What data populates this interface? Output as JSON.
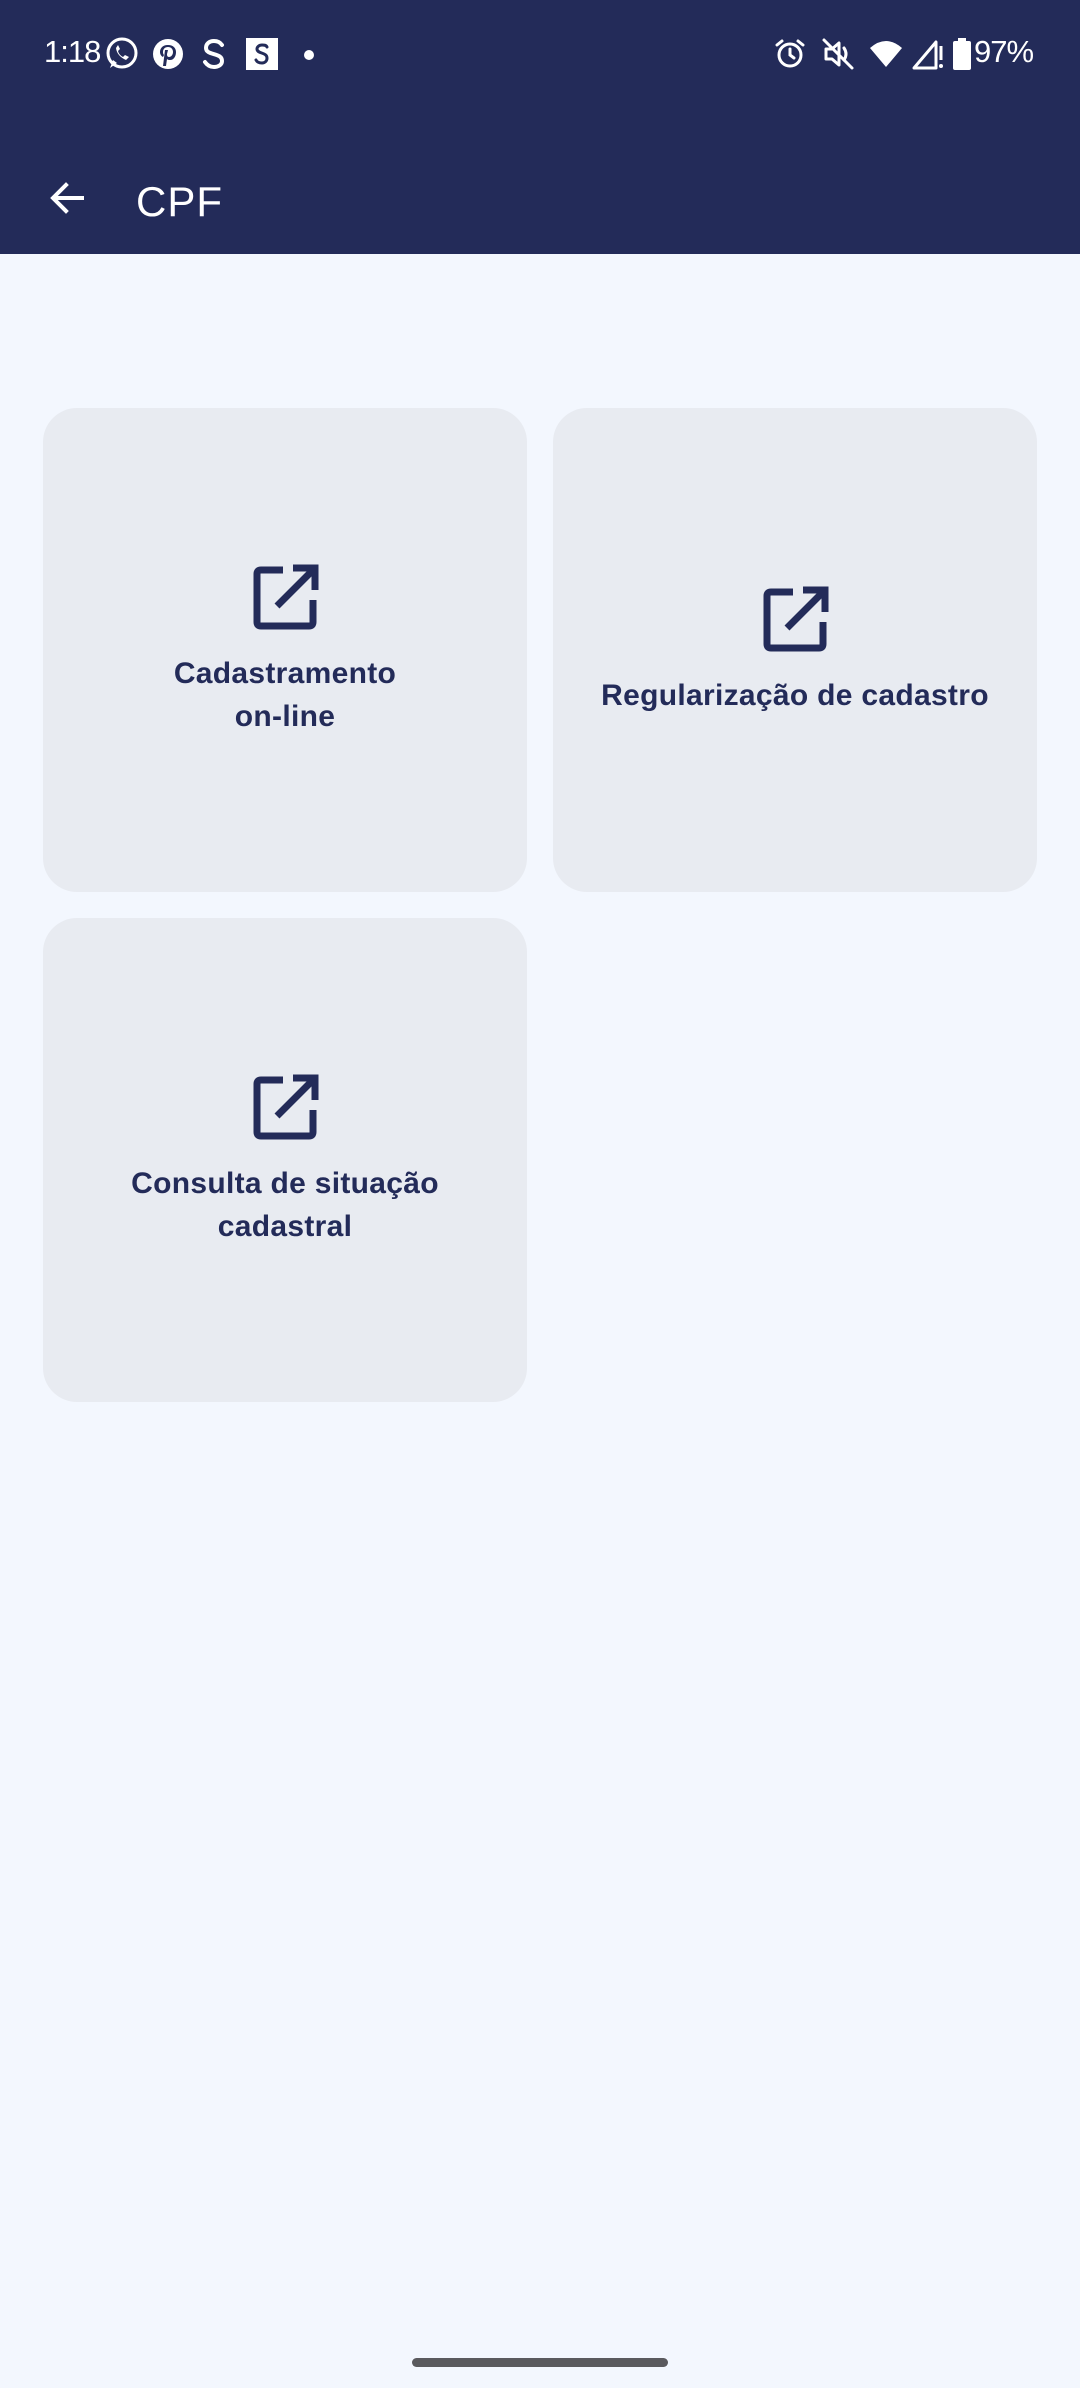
{
  "status_bar": {
    "time": "1:18",
    "battery": "97%",
    "left_icons": [
      "whatsapp-icon",
      "pinterest-icon",
      "s-app-icon",
      "s-square-icon",
      "notification-dot"
    ],
    "right_icons": [
      "alarm-icon",
      "vibrate-off-icon",
      "wifi-icon",
      "signal-icon",
      "battery-icon"
    ]
  },
  "app_bar": {
    "back_icon": "arrow-back-icon",
    "title": "CPF"
  },
  "cards": [
    {
      "label": "Cadastramento on-line",
      "icon": "open-external-icon"
    },
    {
      "label": "Regularização de cadastro",
      "icon": "open-external-icon"
    },
    {
      "label": "Consulta de situação cadastral",
      "icon": "open-external-icon"
    }
  ],
  "colors": {
    "header": "#232b59",
    "background": "#f3f7fe",
    "card": "#e8ebf1",
    "accent": "#232b59"
  }
}
